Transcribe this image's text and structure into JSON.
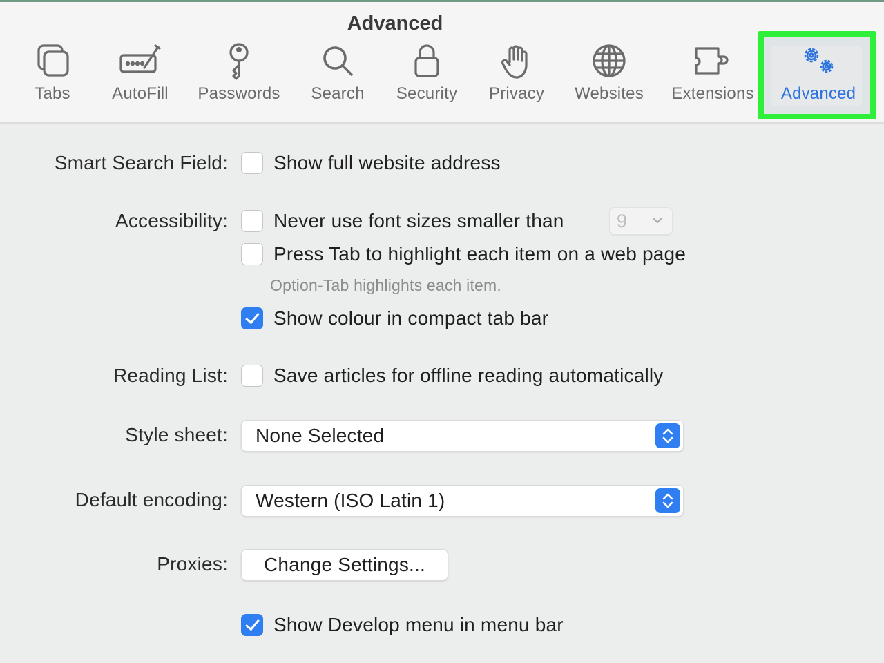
{
  "window": {
    "title": "Advanced"
  },
  "toolbar": {
    "tabs": [
      {
        "label": "Tabs",
        "icon": "tabs-icon"
      },
      {
        "label": "AutoFill",
        "icon": "autofill-icon"
      },
      {
        "label": "Passwords",
        "icon": "key-icon"
      },
      {
        "label": "Search",
        "icon": "search-icon"
      },
      {
        "label": "Security",
        "icon": "lock-icon"
      },
      {
        "label": "Privacy",
        "icon": "hand-icon"
      },
      {
        "label": "Websites",
        "icon": "globe-icon"
      },
      {
        "label": "Extensions",
        "icon": "puzzle-icon"
      },
      {
        "label": "Advanced",
        "icon": "gears-icon",
        "active": true
      }
    ]
  },
  "settings": {
    "smart_search": {
      "label": "Smart Search Field:",
      "option": "Show full website address",
      "checked": false
    },
    "accessibility": {
      "label": "Accessibility:",
      "font_size": {
        "option": "Never use font sizes smaller than",
        "checked": false,
        "value": "9"
      },
      "press_tab": {
        "option": "Press Tab to highlight each item on a web page",
        "checked": false,
        "hint": "Option-Tab highlights each item."
      },
      "colour_tab": {
        "option": "Show colour in compact tab bar",
        "checked": true
      }
    },
    "reading_list": {
      "label": "Reading List:",
      "option": "Save articles for offline reading automatically",
      "checked": false
    },
    "style_sheet": {
      "label": "Style sheet:",
      "value": "None Selected"
    },
    "encoding": {
      "label": "Default encoding:",
      "value": "Western (ISO Latin 1)"
    },
    "proxies": {
      "label": "Proxies:",
      "button": "Change Settings..."
    },
    "develop": {
      "option": "Show Develop menu in menu bar",
      "checked": true
    }
  },
  "colors": {
    "accent": "#2f7ef2",
    "active_tab": "#2c73e0",
    "highlight": "#2ef03a",
    "background": "#eceeed"
  }
}
